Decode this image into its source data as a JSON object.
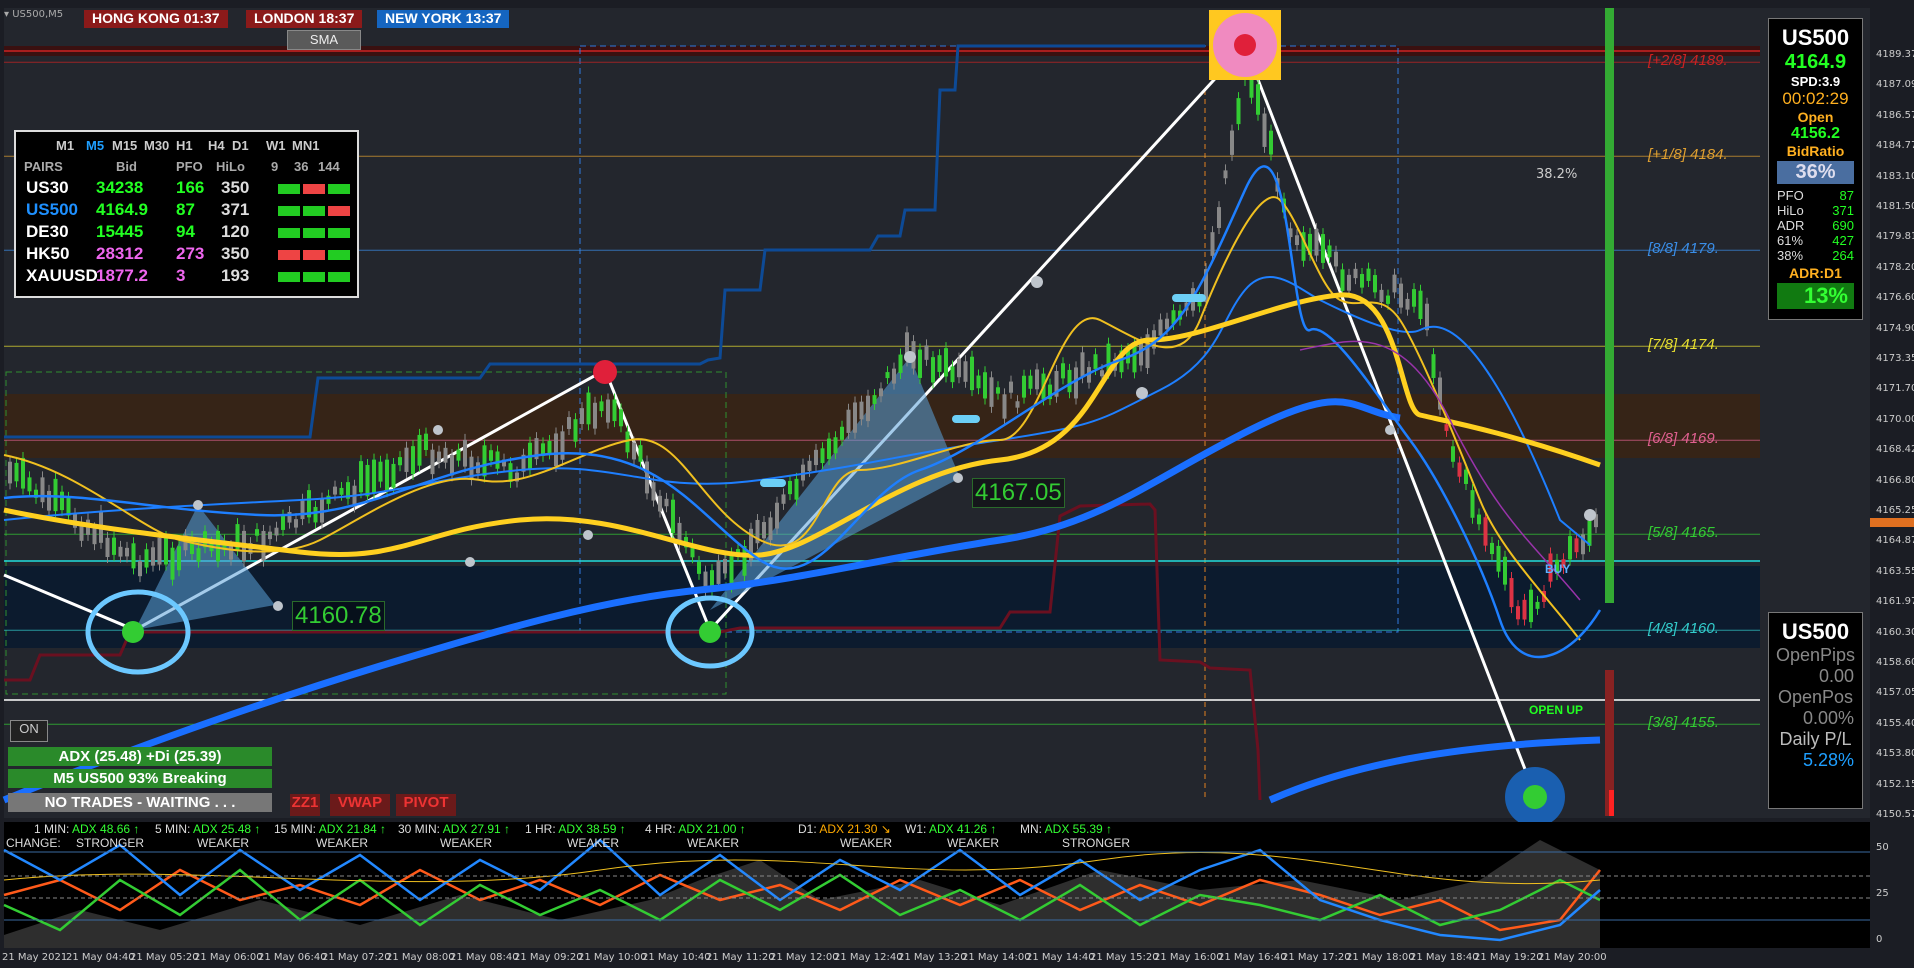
{
  "window": {
    "symbol_tab": "US500,M5"
  },
  "clocks": [
    {
      "label": "HONG KONG 01:37",
      "color": "#8b1a1a"
    },
    {
      "label": "LONDON  18:37",
      "color": "#8b1a1a"
    },
    {
      "label": "NEW YORK 13:37",
      "color": "#1565c0"
    }
  ],
  "sma_button": "SMA",
  "pairs_panel": {
    "timeframes": [
      "M1",
      "M5",
      "M15",
      "M30",
      "H1",
      "H4",
      "D1",
      "W1",
      "MN1"
    ],
    "active_tf": "M5",
    "headers": [
      "PAIRS",
      "Bid",
      "PFO",
      "HiLo",
      "9",
      "36",
      "144"
    ],
    "rows": [
      {
        "pair": "US30",
        "bid": "34238",
        "pfo": "166",
        "hilo": "350",
        "pair_color": "#ffffff",
        "bid_color": "#22ff22",
        "cells": [
          "#22cc22",
          "#ee4444",
          "#22cc22"
        ]
      },
      {
        "pair": "US500",
        "bid": "4164.9",
        "pfo": "87",
        "hilo": "371",
        "pair_color": "#1e90ff",
        "bid_color": "#22ff22",
        "cells": [
          "#22cc22",
          "#22cc22",
          "#ee4444"
        ]
      },
      {
        "pair": "DE30",
        "bid": "15445",
        "pfo": "94",
        "hilo": "120",
        "pair_color": "#ffffff",
        "bid_color": "#22ff22",
        "cells": [
          "#22cc22",
          "#22cc22",
          "#22cc22"
        ]
      },
      {
        "pair": "HK50",
        "bid": "28312",
        "pfo": "273",
        "hilo": "350",
        "pair_color": "#ffffff",
        "bid_color": "#ee66ee",
        "cells": [
          "#ee4444",
          "#ee4444",
          "#22cc22"
        ]
      },
      {
        "pair": "XAUUSD",
        "bid": "1877.2",
        "pfo": "3",
        "hilo": "193",
        "pair_color": "#ffffff",
        "bid_color": "#ee66ee",
        "cells": [
          "#22cc22",
          "#22cc22",
          "#22cc22"
        ]
      }
    ]
  },
  "right_panel": {
    "symbol": "US500",
    "price": "4164.9",
    "spread": "SPD:3.9",
    "timer": "00:02:29",
    "open_label": "Open",
    "open_value": "4156.2",
    "bidratio_label": "BidRatio",
    "bidratio_value": "36%",
    "stats": [
      {
        "k": "PFO",
        "v": "87"
      },
      {
        "k": "HiLo",
        "v": "371"
      },
      {
        "k": "ADR",
        "v": "690"
      },
      {
        "k": "61%",
        "v": "427"
      },
      {
        "k": "38%",
        "v": "264"
      }
    ],
    "adr_label": "ADR:D1",
    "adr_value": "13%"
  },
  "pl_panel": {
    "symbol": "US500",
    "open_pips_label": "OpenPips",
    "open_pips_value": "0.00",
    "open_pos_label": "OpenPos",
    "open_pos_value": "0.00%",
    "daily_pl_label": "Daily P/L",
    "daily_pl_value": "5.28%"
  },
  "murrey_levels": [
    {
      "label": "[+2/8]  4189.",
      "color": "#cc2222",
      "price": 4189.0
    },
    {
      "label": "[+1/8]  4184.",
      "color": "#e0a030",
      "price": 4184.2
    },
    {
      "label": "[8/8]  4179.",
      "color": "#3a8ee8",
      "price": 4179.4
    },
    {
      "label": "[7/8]  4174.",
      "color": "#e8e030",
      "price": 4174.5
    },
    {
      "label": "[6/8]  4169.",
      "color": "#e06090",
      "price": 4169.7
    },
    {
      "label": "[5/8]  4165.",
      "color": "#33cc33",
      "price": 4164.9
    },
    {
      "label": "[4/8]  4160.",
      "color": "#33cccc",
      "price": 4160.0
    },
    {
      "label": "[3/8]  4155.",
      "color": "#33cc33",
      "price": 4155.2
    }
  ],
  "price_axis": [
    "4189.37",
    "4187.09",
    "4186.57",
    "4184.77",
    "4183.10",
    "4181.50",
    "4179.81",
    "4178.20",
    "4176.60",
    "4174.90",
    "4173.35",
    "4171.70",
    "4170.00",
    "4168.42",
    "4166.80",
    "4165.25",
    "4164.87",
    "4163.55",
    "4161.97",
    "4160.30",
    "4158.60",
    "4157.05",
    "4155.40",
    "4153.80",
    "4152.15",
    "4150.57"
  ],
  "fib_label": "38.2%",
  "price_tags": [
    {
      "text": "4160.78",
      "price": 4160.78
    },
    {
      "text": "4167.05",
      "price": 4167.05
    }
  ],
  "chart_labels": {
    "buy": "BUY",
    "open_up": "OPEN UP"
  },
  "on_button": "ON",
  "status": {
    "adx_line": "ADX (25.48)   +Di (25.39)",
    "breaking_line": "M5 US500 93% Breaking",
    "trades_line": "NO TRADES - WAITING . . ."
  },
  "tool_buttons": [
    "ZZ1",
    "VWAP",
    "PIVOT"
  ],
  "adx_bar": [
    {
      "tf": "1 MIN:",
      "val": "ADX 48.66 ↑",
      "sub": "STRONGER",
      "color": "#33ff33"
    },
    {
      "tf": "5 MIN:",
      "val": "ADX 25.48 ↑",
      "sub": "WEAKER",
      "color": "#33ff33"
    },
    {
      "tf": "15 MIN:",
      "val": "ADX 21.84 ↑",
      "sub": "WEAKER",
      "color": "#33ff33"
    },
    {
      "tf": "30 MIN:",
      "val": "ADX 27.91 ↑",
      "sub": "WEAKER",
      "color": "#33ff33"
    },
    {
      "tf": "1 HR:",
      "val": "ADX 38.59 ↑",
      "sub": "WEAKER",
      "color": "#33ff33"
    },
    {
      "tf": "4 HR:",
      "val": "ADX 21.00 ↑",
      "sub": "WEAKER",
      "color": "#33ff33"
    },
    {
      "tf": "D1:",
      "val": "ADX 21.30 ↘",
      "sub": "WEAKER",
      "color": "#ffaa00"
    },
    {
      "tf": "W1:",
      "val": "ADX 41.26 ↑",
      "sub": "WEAKER",
      "color": "#33ff33"
    },
    {
      "tf": "MN:",
      "val": "ADX 55.39 ↑",
      "sub": "STRONGER",
      "color": "#33ff33"
    }
  ],
  "change_label": "CHANGE:",
  "sub_axis": [
    "50",
    "25",
    "0"
  ],
  "time_axis": [
    "21 May 2021",
    "21 May 04:40",
    "21 May 05:20",
    "21 May 06:00",
    "21 May 06:40",
    "21 May 07:20",
    "21 May 08:00",
    "21 May 08:40",
    "21 May 09:20",
    "21 May 10:00",
    "21 May 10:40",
    "21 May 11:20",
    "21 May 12:00",
    "21 May 12:40",
    "21 May 13:20",
    "21 May 14:00",
    "21 May 14:40",
    "21 May 15:20",
    "21 May 16:00",
    "21 May 16:40",
    "21 May 17:20",
    "21 May 18:00",
    "21 May 18:40",
    "21 May 19:20",
    "21 May 20:00"
  ],
  "colors": {
    "bull": "#33cc33",
    "bear": "#dd3344",
    "neutral": "#888888",
    "ema_blue": "#1e7fff",
    "sma_yellow": "#f0c020"
  }
}
